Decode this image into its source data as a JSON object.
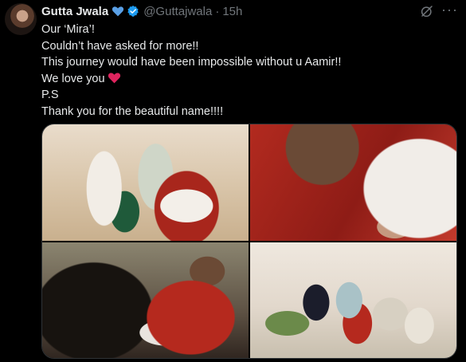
{
  "tweet": {
    "author": {
      "name": "Gutta Jwala",
      "handle": "@Guttajwala",
      "time": "15h"
    },
    "icons": {
      "name_badge": "blue-heart-icon",
      "verified": "verified-badge-icon",
      "grok": "grok-icon",
      "more": "more-options-icon",
      "inline_heart": "red-heart-icon"
    },
    "colors": {
      "verified": "#1d9bf0",
      "heart_blue": "#5aa0e6",
      "heart_red": "#e0245e"
    },
    "more_symbol": "···",
    "lines": [
      "Our ‘Mira’!",
      "Couldn’t have asked for more!!",
      "This journey would have been impossible without u Aamir!!",
      "We love you",
      "P.S",
      "Thank you for the beautiful name!!!!"
    ]
  }
}
